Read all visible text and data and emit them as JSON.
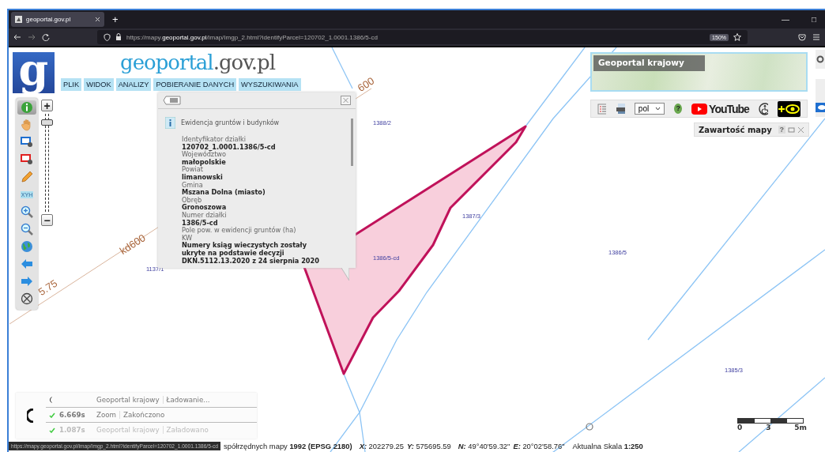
{
  "browser": {
    "tab_title": "geoportal.gov.pl",
    "new_tab": "+",
    "window_controls": [
      "—",
      "□"
    ],
    "url_prefix": "https://mapy.",
    "url_domain": "geoportal.gov.pl",
    "url_path": "/imap/Imgp_2.html?identifyParcel=120702_1.0001.1386/5-cd",
    "zoom": "150%"
  },
  "header": {
    "logo_letter": "g",
    "site_name": "geoportal",
    "site_domain": ".gov.pl"
  },
  "menu": [
    "PLIK",
    "WIDOK",
    "ANALIZY",
    "POBIERANIE DANYCH",
    "WYSZUKIWANIA"
  ],
  "tools": [
    {
      "kind": "info",
      "selected": true
    },
    {
      "kind": "pan",
      "selected": false
    },
    {
      "kind": "area-select",
      "selected": false
    },
    {
      "kind": "area-clear",
      "selected": false
    },
    {
      "kind": "pencil",
      "selected": false
    },
    {
      "kind": "xyh",
      "label": "XYH",
      "selected": false
    },
    {
      "kind": "zoom-in",
      "selected": false
    },
    {
      "kind": "zoom-out",
      "selected": false
    },
    {
      "kind": "globe",
      "selected": false
    },
    {
      "kind": "back",
      "selected": false
    },
    {
      "kind": "forward",
      "selected": false
    },
    {
      "kind": "crosshair",
      "selected": false
    }
  ],
  "zoom_slider": {
    "plus": "+",
    "minus": "−",
    "level": 0.92
  },
  "popup": {
    "title": "Ewidencja gruntów i budynków",
    "fields": [
      {
        "label": "Identyfikator działki",
        "value": "120702_1.0001.1386/5-cd"
      },
      {
        "label": "Województwo",
        "value": "małopolskie"
      },
      {
        "label": "Powiat",
        "value": "limanowski"
      },
      {
        "label": "Gmina",
        "value": "Mszana Dolna (miasto)"
      },
      {
        "label": "Obręb",
        "value": "Gronoszowa"
      },
      {
        "label": "Numer działki",
        "value": "1386/5-cd"
      },
      {
        "label": "Pole pow. w ewidencji gruntów (ha)"
      },
      {
        "label": "KW",
        "value": "Numery ksiąg wieczystych zostały ukryte na podstawie decyzji DKN.5112.13.2020 z 24 sierpnia 2020"
      }
    ]
  },
  "basemap": {
    "title": "Geoportal krajowy"
  },
  "toolbar": [
    {
      "kind": "legend"
    },
    {
      "kind": "print"
    },
    {
      "kind": "language",
      "value": "pol"
    },
    {
      "kind": "help",
      "label": "?"
    },
    {
      "kind": "youtube",
      "label": "YouTube"
    },
    {
      "kind": "accessibility"
    },
    {
      "kind": "contrast"
    }
  ],
  "map_contents": {
    "title": "Zawartość mapy",
    "help": "?"
  },
  "map": {
    "parcel_labels": [
      "1388/2",
      "1387/3",
      "1386/5-cd",
      "1386/5",
      "1137/1",
      "1385/3"
    ],
    "line_labels": [
      "600",
      "kd600",
      "5.75"
    ]
  },
  "loading": [
    {
      "done": false,
      "dimmed": false,
      "source": "Geoportal krajowy",
      "status": "Ładowanie..."
    },
    {
      "done": true,
      "dimmed": false,
      "time": "6.669s",
      "source": "Zoom",
      "status": "Zakończono"
    },
    {
      "done": true,
      "dimmed": true,
      "time": "1.087s",
      "source": "Geoportal krajowy",
      "status": "Załadowano"
    }
  ],
  "scale_bar": [
    "0",
    "3",
    "5m"
  ],
  "status_bar": {
    "url_tooltip": "https://mapy.geoportal.gov.pl/imap/Imgp_2.html?identifyParcel=120702_1.0001.1386/5-cd",
    "system": "spółrzędnych mapy **1992 (EPSG 2180)**",
    "coords": [
      {
        "label": "X:",
        "value": "202279.25"
      },
      {
        "label": "Y:",
        "value": "575695.59"
      },
      {
        "label": "N:",
        "value": "49°40'59.32\""
      },
      {
        "label": "E:",
        "value": "20°02'58.76\""
      }
    ],
    "scale": "Aktualna Skala **1:250**"
  }
}
